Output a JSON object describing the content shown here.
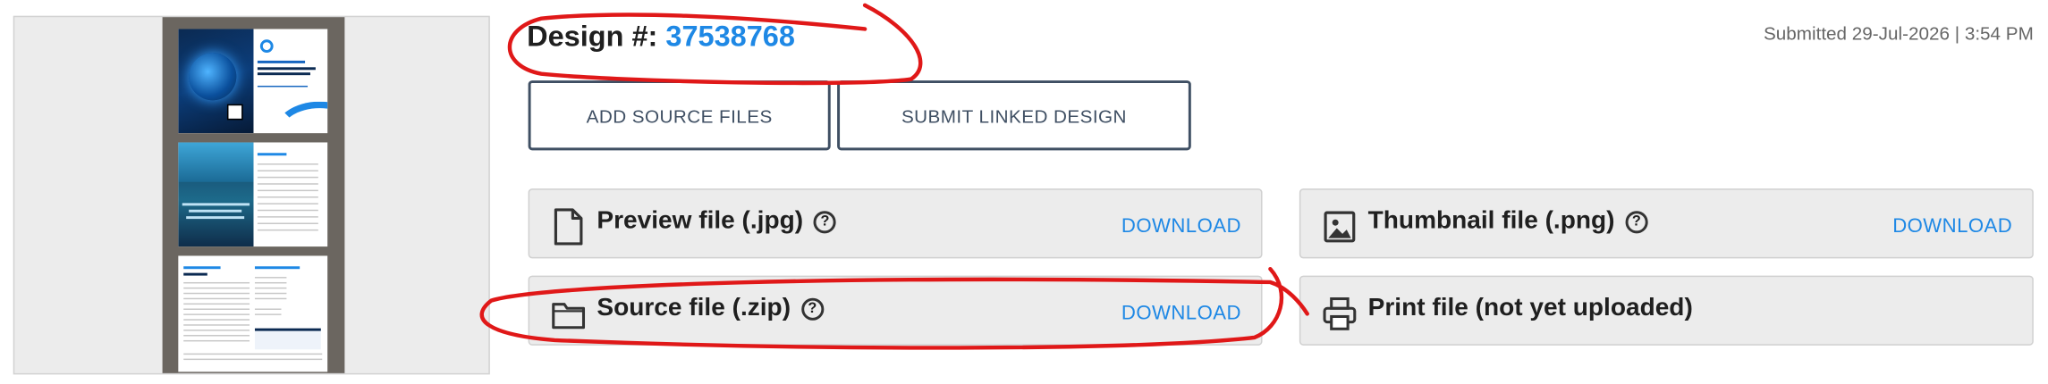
{
  "design": {
    "label": "Design #:",
    "number": "37538768",
    "submitted": "Submitted 29-Jul-2026 | 3:54 PM"
  },
  "actions": {
    "add_source": "ADD SOURCE FILES",
    "submit_linked": "SUBMIT LINKED DESIGN"
  },
  "files": [
    {
      "label": "Preview file (.jpg)",
      "help": "?",
      "download": "DOWNLOAD",
      "icon": "file-icon"
    },
    {
      "label": "Thumbnail file (.png)",
      "help": "?",
      "download": "DOWNLOAD",
      "icon": "image-icon"
    },
    {
      "label": "Source file (.zip)",
      "help": "?",
      "download": "DOWNLOAD",
      "icon": "folder-icon"
    },
    {
      "label": "Print file (not yet uploaded)",
      "icon": "printer-icon"
    }
  ],
  "thumbnail": {
    "page1_lines": [
      "INTERCHANGE LIMITED",
      "STRATEGY OVERVIEW",
      "PURCHASE 25% OF PRIMA"
    ],
    "page2_cover": [
      "CONSOLIDATION",
      "GROWTH &",
      "PARTNERSHIP"
    ],
    "page2_toc": "Table of Contents",
    "page3_left": "Executive Summary",
    "page3_overview": "Overview",
    "page3_right": "Ownership & Structure"
  },
  "colors": {
    "accent": "#1e88e5",
    "annotation": "#e01818",
    "button_border": "#3f4f63",
    "card_bg": "#ececec"
  }
}
